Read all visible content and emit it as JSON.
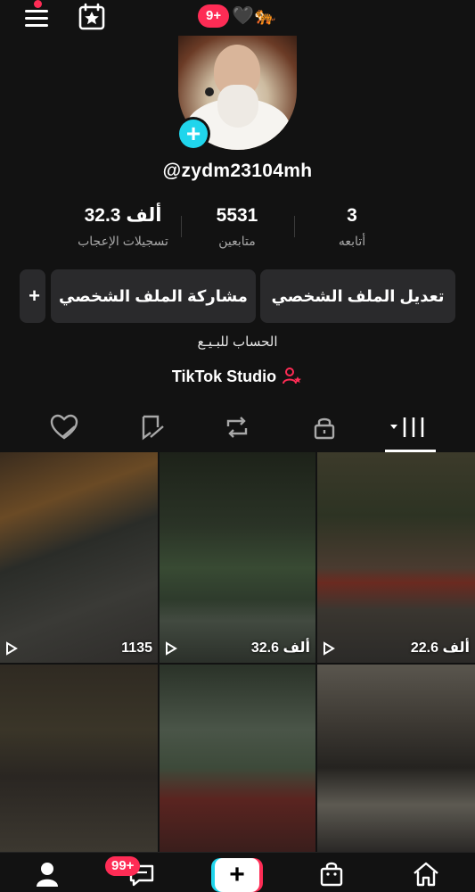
{
  "topbar": {
    "notif_count": "9+",
    "emoji": "🖤🐅"
  },
  "profile": {
    "username": "@zydm23104mh",
    "bio": "الحساب للبـيـع",
    "studio_label": "TikTok Studio"
  },
  "stats": [
    {
      "value": "32.3 ألف",
      "label": "تسجيلات الإعجاب"
    },
    {
      "value": "5531",
      "label": "متابعين"
    },
    {
      "value": "3",
      "label": "أتابعه"
    }
  ],
  "buttons": {
    "edit_profile": "تعديل الملف الشخصي",
    "share_profile": "مشاركة الملف الشخصي",
    "add_friends": "+"
  },
  "videos": [
    {
      "views": "22.6 ألف"
    },
    {
      "views": "32.6 ألف"
    },
    {
      "views": "1135"
    },
    {
      "views": ""
    },
    {
      "views": ""
    },
    {
      "views": ""
    }
  ],
  "bottomnav": {
    "inbox_badge": "99+",
    "create_label": "+"
  },
  "colors": {
    "accent_red": "#fe2c55",
    "accent_cyan": "#20d5ec",
    "background": "#121212",
    "button_bg": "#2a2a2c"
  }
}
